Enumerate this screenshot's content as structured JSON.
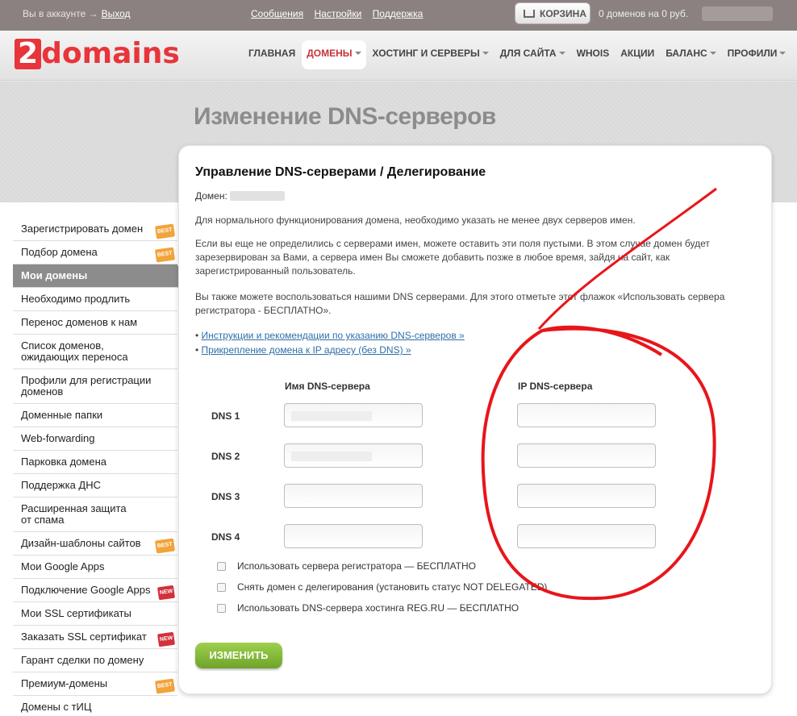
{
  "topbar": {
    "acct_text": "Вы в аккаунте →",
    "logout": "Выход",
    "links": [
      "Сообщения",
      "Настройки",
      "Поддержка"
    ],
    "cart_label": "КОРЗИНА",
    "cart_info": "0 доменов на 0 руб."
  },
  "logo": {
    "two": "2",
    "rest": "domains"
  },
  "nav": [
    "ГЛАВНАЯ",
    "ДОМЕНЫ",
    "ХОСТИНГ И СЕРВЕРЫ",
    "ДЛЯ САЙТА",
    "WHOIS",
    "АКЦИИ",
    "БАЛАНС",
    "ПРОФИЛИ"
  ],
  "page_title": "Изменение DNS-серверов",
  "sidebar": [
    {
      "label": "Зарегистрировать домен",
      "badge": "BEST"
    },
    {
      "label": "Подбор домена",
      "badge": "BEST"
    },
    {
      "label": "Мои домены"
    },
    {
      "label": "Необходимо продлить"
    },
    {
      "label": "Перенос доменов к нам"
    },
    {
      "label": "Список доменов,\nожидающих переноса"
    },
    {
      "label": "Профили для регистрации\nдоменов"
    },
    {
      "label": "Доменные папки"
    },
    {
      "label": "Web-forwarding"
    },
    {
      "label": "Парковка домена"
    },
    {
      "label": "Поддержка ДНС"
    },
    {
      "label": "Расширенная защита\nот спама"
    },
    {
      "label": "Дизайн-шаблоны сайтов",
      "badge": "BEST"
    },
    {
      "label": "Мои Google Apps"
    },
    {
      "label": "Подключение Google Apps",
      "badge": "NEW"
    },
    {
      "label": "Мои SSL сертификаты"
    },
    {
      "label": "Заказать SSL сертификат",
      "badge": "NEW"
    },
    {
      "label": "Гарант сделки по домену"
    },
    {
      "label": "Премиум-домены",
      "badge": "BEST"
    },
    {
      "label": "Домены с тИЦ"
    }
  ],
  "panel": {
    "heading": "Управление DNS-серверами / Делегирование",
    "domain_label": "Домен:",
    "p1": "Для нормального функционирования домена, необходимо указать не менее двух серверов имен.",
    "p2a": "Если вы еще не определились с серверами имен, можете оставить эти поля пустыми. В этом случае домен будет",
    "p2b": "зарезервирован за Вами, а сервера имен Вы сможете добавить позже в любое время, зайдя на сайт, как",
    "p2c": "зарегистрированный пользователь.",
    "p3a": "Вы также можете воспользоваться нашими DNS серверами. Для этого отметьте этот флажок «Использовать сервера",
    "p3b": "регистратора - БЕСПЛАТНО».",
    "link1": "Инструкции и рекомендации по указанию DNS-серверов »",
    "link2": "Прикрепление домена к IP адресу (без DNS) »",
    "col_name": "Имя DNS-сервера",
    "col_ip": "IP DNS-сервера",
    "dns_labels": [
      "DNS 1",
      "DNS 2",
      "DNS 3",
      "DNS 4"
    ],
    "checks": [
      "Использовать сервера регистратора — БЕСПЛАТНО",
      "Снять домен с делегирования (установить статус NOT DELEGATED)",
      "Использовать DNS-сервера хостинга REG.RU — БЕСПЛАТНО"
    ],
    "submit": "ИЗМЕНИТЬ"
  },
  "colors": {
    "accent": "#e7353b",
    "topbar": "#8a8180",
    "button": "#7fb534",
    "annotation": "#e8151a"
  }
}
